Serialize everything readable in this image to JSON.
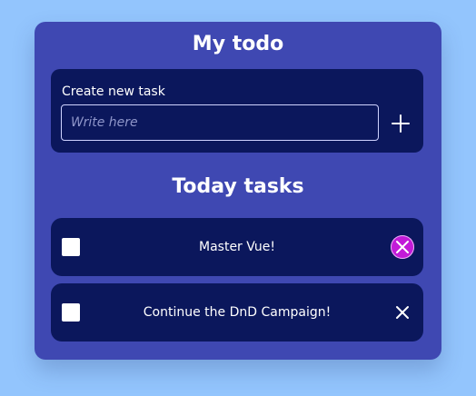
{
  "app": {
    "title": "My todo"
  },
  "create": {
    "label": "Create new task",
    "input_placeholder": "Write here",
    "input_value": "",
    "add_icon": "plus-icon"
  },
  "tasks_section": {
    "title": "Today tasks"
  },
  "tasks": [
    {
      "text": "Master Vue!",
      "done": false,
      "delete_icon": "close-circle-icon",
      "delete_highlighted": true,
      "highlight_color": "#c21bd8"
    },
    {
      "text": "Continue the DnD Campaign!",
      "done": false,
      "delete_icon": "close-icon",
      "delete_highlighted": false
    }
  ]
}
